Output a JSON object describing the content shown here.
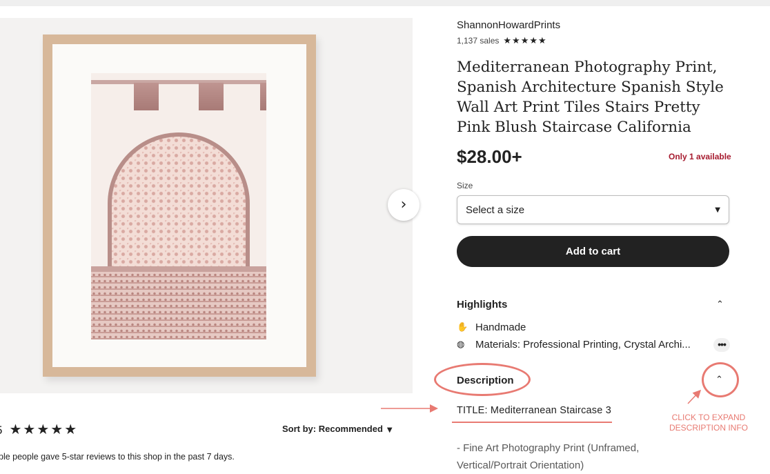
{
  "product": {
    "shop_name": "ShannonHowardPrints",
    "sales": "1,137 sales",
    "shop_stars": "★★★★★",
    "title": "Mediterranean Photography Print, Spanish Architecture Spanish Style Wall Art Print Tiles Stairs Pretty Pink Blush Staircase California",
    "price": "$28.00+",
    "availability": "Only 1 available",
    "size_label": "Size",
    "size_select_value": "Select a size",
    "add_to_cart": "Add to cart"
  },
  "highlights": {
    "title": "Highlights",
    "items": [
      {
        "icon": "hand-icon",
        "text": "Handmade"
      },
      {
        "icon": "materials-icon",
        "text": "Materials: Professional Printing, Crystal Archi..."
      }
    ]
  },
  "description": {
    "title": "Description",
    "line1": "TITLE: Mediterranean Staircase 3",
    "line2": "- Fine Art Photography Print (Unframed, Vertical/Portrait Orientation)"
  },
  "annotation": {
    "text": "CLICK TO EXPAND DESCRIPTION INFO",
    "color": "#e87a72"
  },
  "reviews": {
    "count_partial": "5",
    "stars": "★★★★★",
    "sort_label": "Sort by: Recommended",
    "note": "ple people gave 5-star reviews to this shop in the past 7 days."
  },
  "colors": {
    "availability": "#a61a2e",
    "cart_button": "#222222"
  }
}
